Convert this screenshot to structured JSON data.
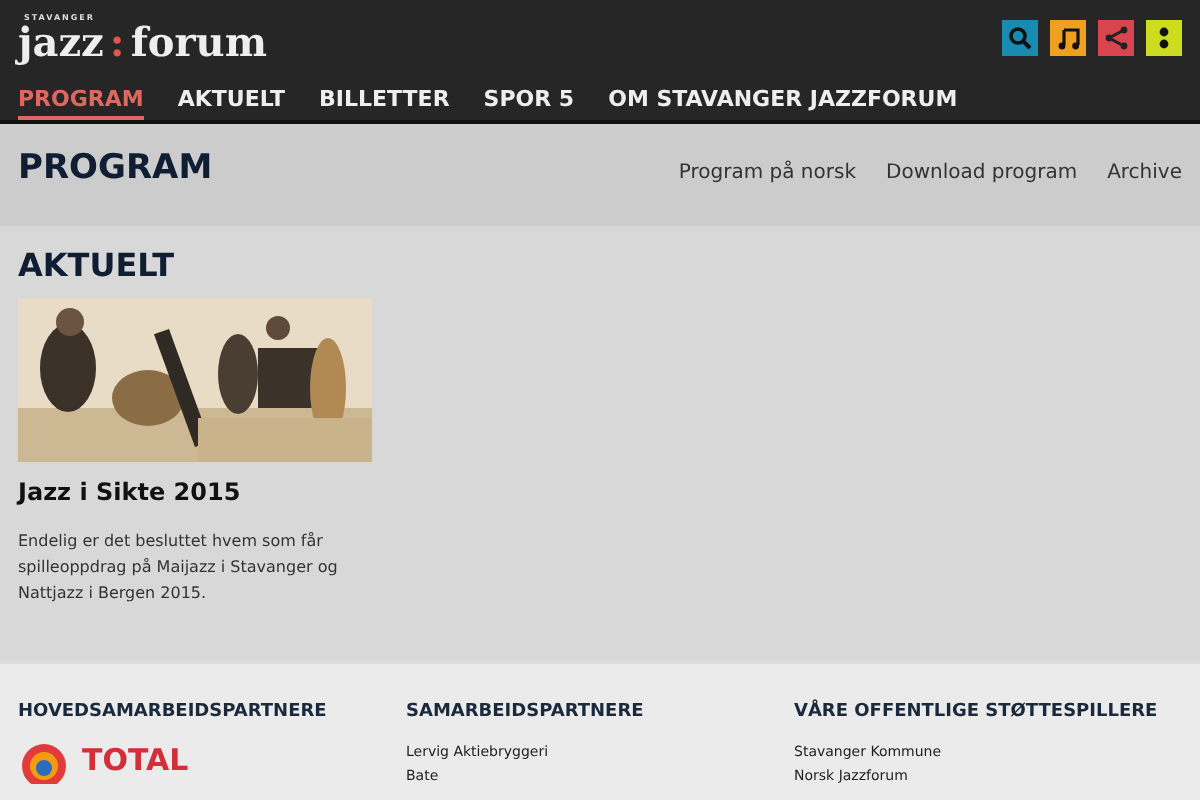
{
  "header": {
    "logo": {
      "small": "STAVANGER",
      "left": "jazz",
      "colon": ":",
      "right": "forum"
    },
    "actions": [
      {
        "kind": "search",
        "color": "#1a8bb0"
      },
      {
        "kind": "music",
        "color": "#f0a020"
      },
      {
        "kind": "share",
        "color": "#d9454f"
      },
      {
        "kind": "more",
        "color": "#cddc1f"
      }
    ]
  },
  "nav": [
    {
      "label": "PROGRAM",
      "selected": true
    },
    {
      "label": "AKTUELT",
      "selected": false
    },
    {
      "label": "BILLETTER",
      "selected": false
    },
    {
      "label": "SPOR 5",
      "selected": false
    },
    {
      "label": "OM STAVANGER JAZZFORUM",
      "selected": false
    }
  ],
  "page_header": {
    "title": "PROGRAM",
    "links": [
      "Program på norsk",
      "Download program",
      "Archive"
    ]
  },
  "section": {
    "title": "AKTUELT",
    "article": {
      "title": "Jazz i Sikte 2015",
      "text": "Endelig er det besluttet hvem som får spilleoppdrag på Maijazz i Stavanger og Nattjazz i Bergen 2015."
    }
  },
  "footer": [
    {
      "title": "HOVEDSAMARBEIDSPARTNERE",
      "kind": "logo",
      "logo_text": "TOTAL"
    },
    {
      "title": "SAMARBEIDSPARTNERE",
      "kind": "list",
      "items": [
        "Lervig Aktiebryggeri",
        "Bate"
      ]
    },
    {
      "title": "VÅRE OFFENTLIGE STØTTESPILLERE",
      "kind": "list",
      "items": [
        "Stavanger Kommune",
        "Norsk Jazzforum"
      ]
    }
  ]
}
